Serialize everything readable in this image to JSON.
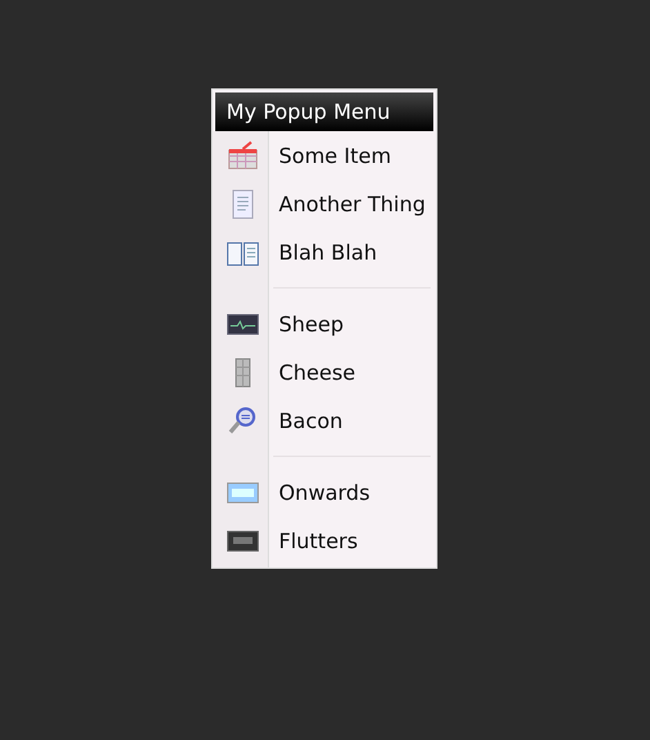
{
  "menu": {
    "title": "My Popup Menu",
    "groups": [
      [
        {
          "label": "Some Item"
        },
        {
          "label": "Another Thing"
        },
        {
          "label": "Blah Blah"
        }
      ],
      [
        {
          "label": "Sheep"
        },
        {
          "label": "Cheese"
        },
        {
          "label": "Bacon"
        }
      ],
      [
        {
          "label": "Onwards"
        },
        {
          "label": "Flutters"
        }
      ]
    ]
  }
}
